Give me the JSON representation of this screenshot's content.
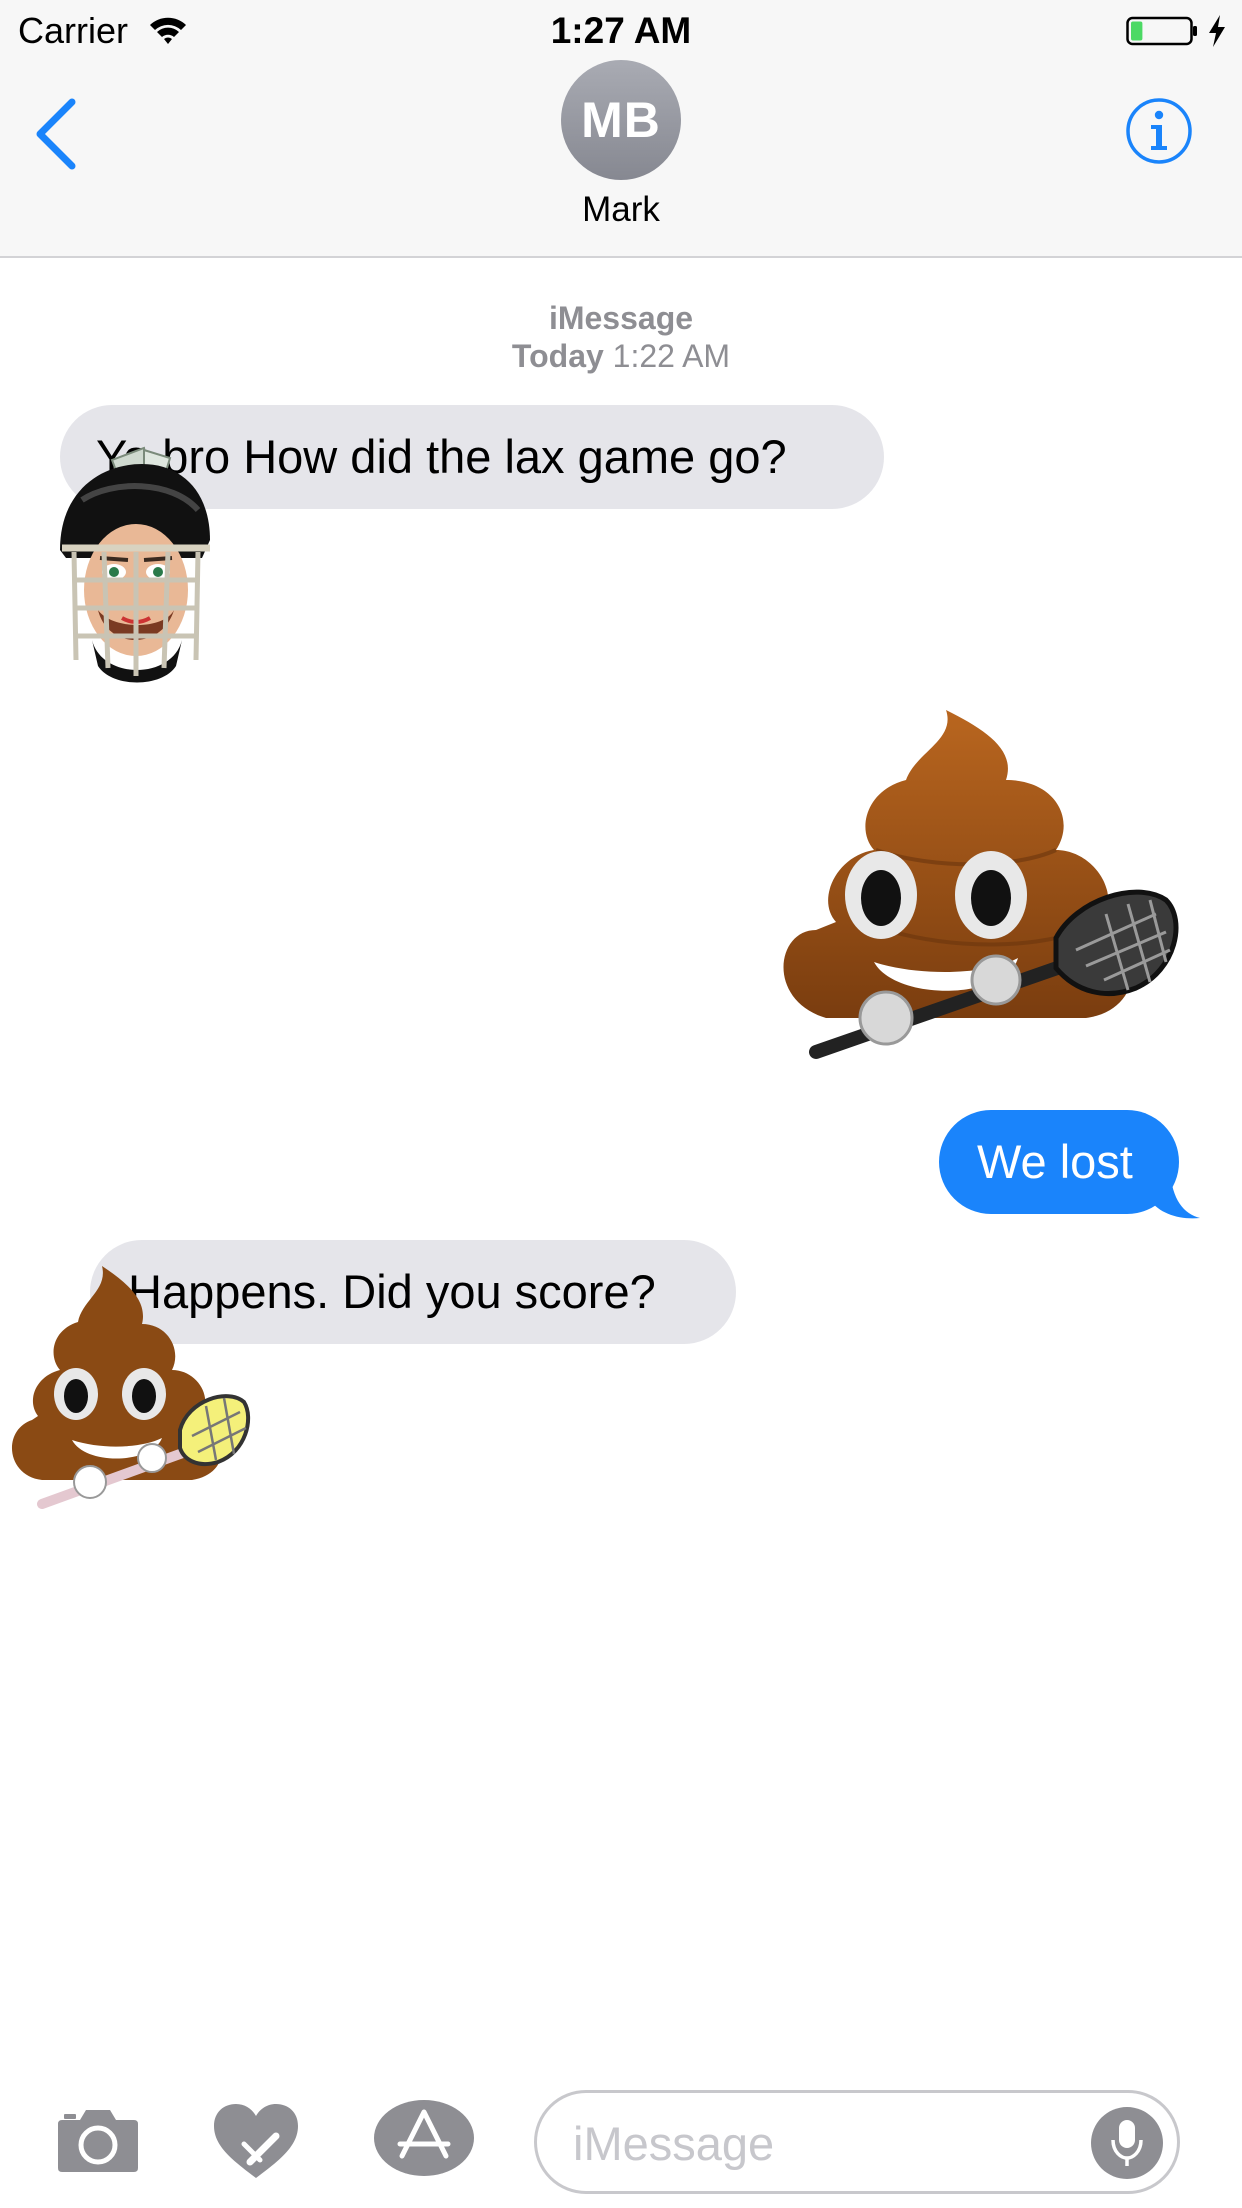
{
  "status_bar": {
    "carrier": "Carrier",
    "time": "1:27 AM",
    "wifi_icon": "wifi-icon",
    "battery_icon": "battery-icon",
    "charging_icon": "bolt-icon",
    "battery_level": 0.2
  },
  "nav": {
    "back_icon": "chevron-left-icon",
    "avatar_initials": "MB",
    "contact_name": "Mark",
    "info_icon": "info-icon"
  },
  "conversation": {
    "service": "iMessage",
    "timestamp_day": "Today",
    "timestamp_time": "1:22 AM",
    "messages": [
      {
        "direction": "incoming",
        "text": "Yo bro How did the lax game go?"
      },
      {
        "direction": "outgoing",
        "sticker": "poop-lacrosse-sticker"
      },
      {
        "direction": "outgoing",
        "text": "We lost"
      },
      {
        "direction": "incoming",
        "text": "Happens. Did you score?"
      }
    ],
    "stickers": [
      "lacrosse-helmet-sticker",
      "poop-lacrosse-sticker",
      "poop-lacrosse-sticker"
    ]
  },
  "input_bar": {
    "camera_icon": "camera-icon",
    "digital_touch_icon": "digital-touch-heart-icon",
    "app_store_icon": "app-store-icon",
    "placeholder": "iMessage",
    "mic_icon": "microphone-icon"
  },
  "colors": {
    "accent": "#1a84fb",
    "incoming_bubble": "#e5e5ea",
    "bar_background": "#f7f7f7",
    "secondary_text": "#8e8e93",
    "battery_fill": "#4cd964"
  }
}
